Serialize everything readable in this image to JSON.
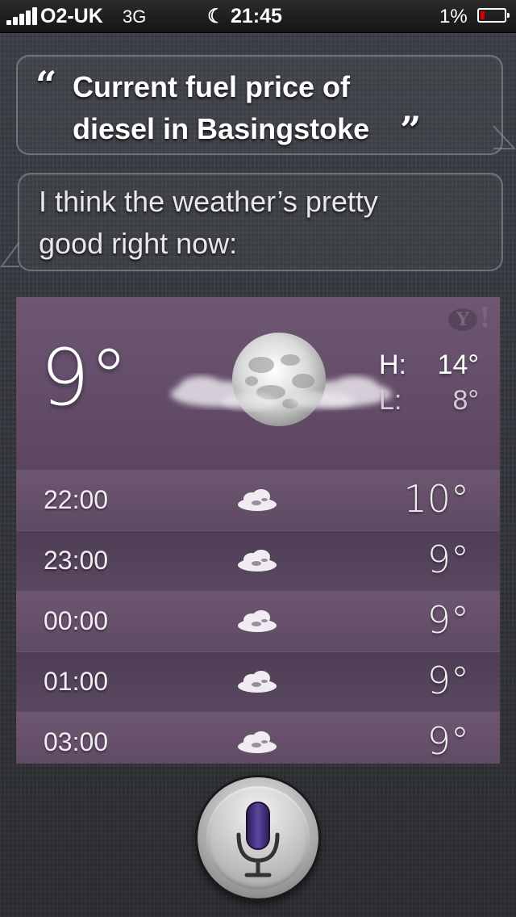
{
  "status_bar": {
    "carrier": "O2-UK",
    "network": "3G",
    "do_not_disturb_icon": "moon-icon",
    "time": "21:45",
    "battery_percent": "1%",
    "battery_level": 0.01,
    "battery_color": "#d40000"
  },
  "conversation": {
    "user_query_line1": "Current fuel price of",
    "user_query_line2": "diesel in Basingstoke",
    "open_quote": "“",
    "close_quote": "”",
    "siri_response_line1": "I think the weather’s pretty",
    "siri_response_line2": "good right now:"
  },
  "weather": {
    "provider_icon": "yahoo-icon",
    "provider_mark": "Y",
    "provider_bang": "!",
    "current_temp": "9°",
    "current_condition_icon": "moon-with-clouds-icon",
    "high": "H:",
    "high_value": "14°",
    "low": "L:",
    "low_value": "8°",
    "accent_color": "#5f4a66",
    "hourly": [
      {
        "time": "22:00",
        "icon": "cloudy-icon",
        "temp": "10°"
      },
      {
        "time": "23:00",
        "icon": "cloudy-icon",
        "temp": "9°"
      },
      {
        "time": "00:00",
        "icon": "cloudy-icon",
        "temp": "9°"
      },
      {
        "time": "01:00",
        "icon": "cloudy-icon",
        "temp": "9°"
      },
      {
        "time": "03:00",
        "icon": "cloudy-icon",
        "temp": "9°"
      }
    ]
  },
  "siri": {
    "mic_icon": "microphone-icon",
    "mic_color": "#3b2a70"
  }
}
